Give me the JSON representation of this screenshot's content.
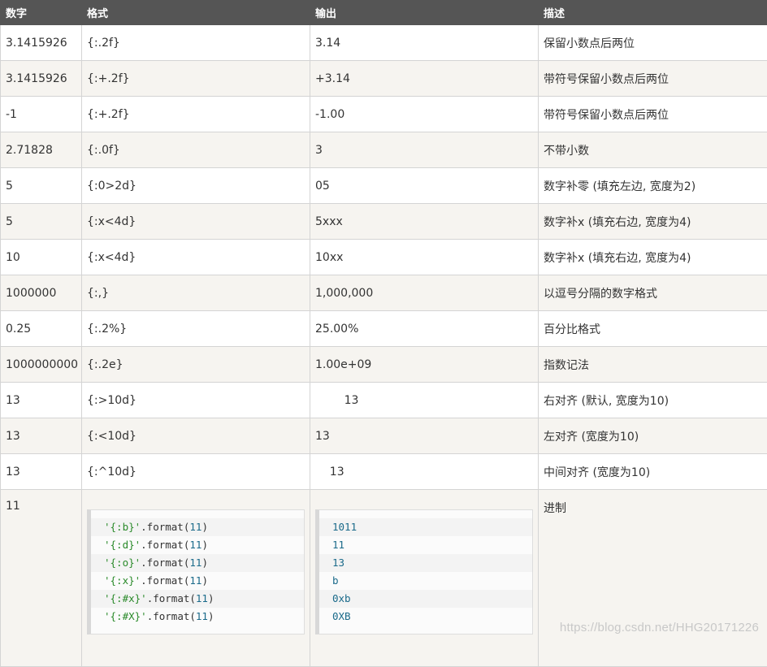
{
  "headers": [
    "数字",
    "格式",
    "输出",
    "描述"
  ],
  "rows": [
    {
      "number": "3.1415926",
      "format": "{:.2f}",
      "output": "3.14",
      "desc": "保留小数点后两位"
    },
    {
      "number": "3.1415926",
      "format": "{:+.2f}",
      "output": "+3.14",
      "desc": "带符号保留小数点后两位"
    },
    {
      "number": "-1",
      "format": "{:+.2f}",
      "output": "-1.00",
      "desc": "带符号保留小数点后两位"
    },
    {
      "number": "2.71828",
      "format": "{:.0f}",
      "output": "3",
      "desc": "不带小数"
    },
    {
      "number": "5",
      "format": "{:0>2d}",
      "output": "05",
      "desc": "数字补零 (填充左边, 宽度为2)"
    },
    {
      "number": "5",
      "format": "{:x<4d}",
      "output": "5xxx",
      "desc": "数字补x (填充右边, 宽度为4)"
    },
    {
      "number": "10",
      "format": "{:x<4d}",
      "output": "10xx",
      "desc": "数字补x (填充右边, 宽度为4)"
    },
    {
      "number": "1000000",
      "format": "{:,}",
      "output": "1,000,000",
      "desc": "以逗号分隔的数字格式"
    },
    {
      "number": "0.25",
      "format": "{:.2%}",
      "output": "25.00%",
      "desc": "百分比格式"
    },
    {
      "number": "1000000000",
      "format": "{:.2e}",
      "output": "1.00e+09",
      "desc": "指数记法"
    },
    {
      "number": "13",
      "format": "{:>10d}",
      "output": "        13",
      "desc": "右对齐 (默认, 宽度为10)"
    },
    {
      "number": "13",
      "format": "{:<10d}",
      "output": "13",
      "desc": "左对齐 (宽度为10)"
    },
    {
      "number": "13",
      "format": "{:^10d}",
      "output": "    13",
      "desc": "中间对齐 (宽度为10)"
    }
  ],
  "base_row": {
    "number": "11",
    "desc": "进制",
    "code_lines": [
      {
        "str": "'{:b}'",
        "method": ".format(",
        "arg": "11",
        "close": ")"
      },
      {
        "str": "'{:d}'",
        "method": ".format(",
        "arg": "11",
        "close": ")"
      },
      {
        "str": "'{:o}'",
        "method": ".format(",
        "arg": "11",
        "close": ")"
      },
      {
        "str": "'{:x}'",
        "method": ".format(",
        "arg": "11",
        "close": ")"
      },
      {
        "str": "'{:#x}'",
        "method": ".format(",
        "arg": "11",
        "close": ")"
      },
      {
        "str": "'{:#X}'",
        "method": ".format(",
        "arg": "11",
        "close": ")"
      }
    ],
    "outputs": [
      "1011",
      "11",
      "13",
      "b",
      "0xb",
      "0XB"
    ]
  },
  "watermark": "https://blog.csdn.net/HHG20171226",
  "colors": {
    "header_bg": "#555555",
    "header_text": "#ffffff",
    "row_alt_bg": "#f6f4f0",
    "string_literal": "#2a8a2a",
    "number_literal": "#1a6a8a"
  }
}
